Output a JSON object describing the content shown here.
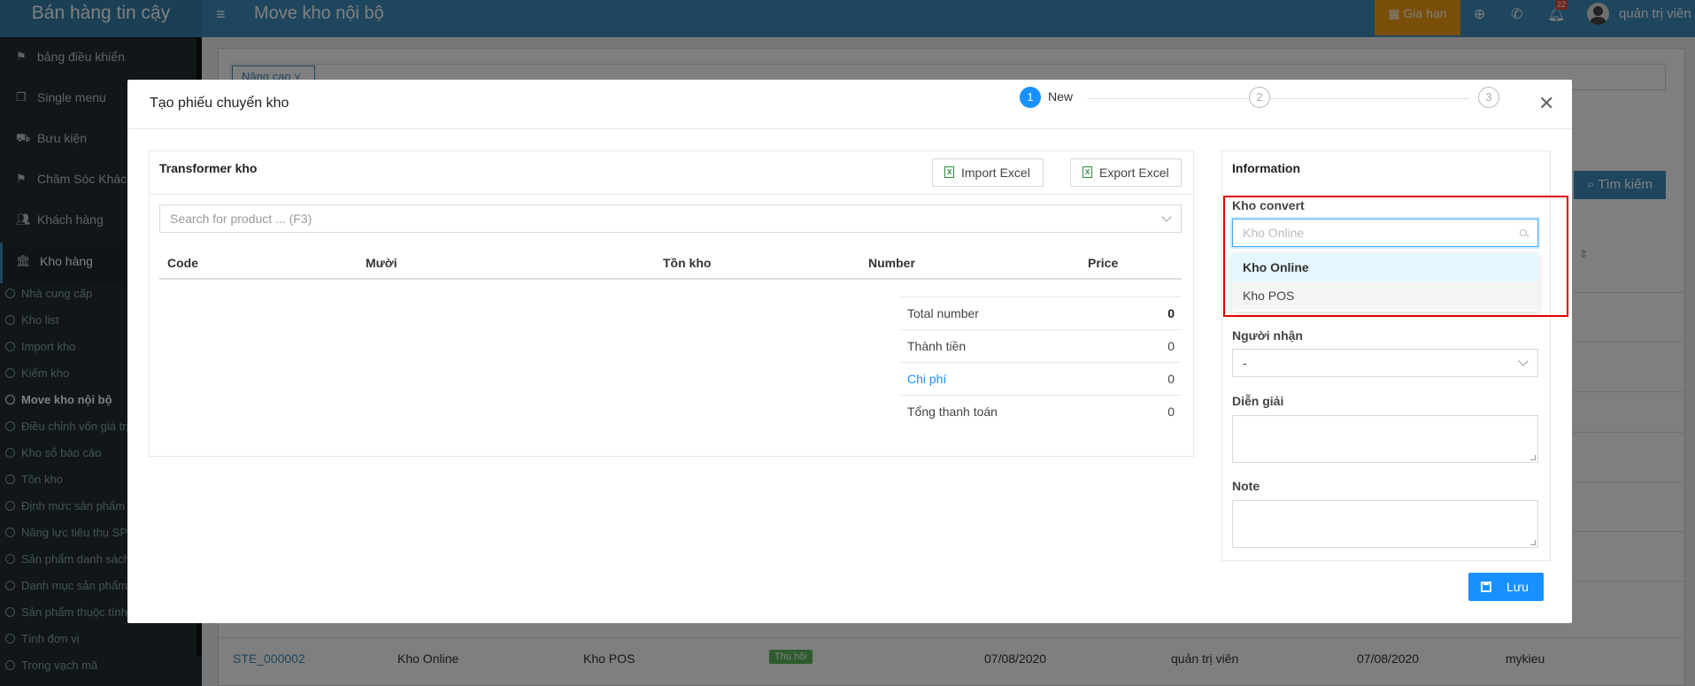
{
  "app": {
    "brand": "Bán hàng tin cậy",
    "page_title": "Move kho nội bộ"
  },
  "topbar": {
    "renew_label": "Gia hạn",
    "notif_count": "22",
    "user_name": "quản trị viên"
  },
  "sidebar": {
    "items": [
      {
        "label": "bảng điều khiển",
        "icon": "flag-icon"
      },
      {
        "label": "Single menu",
        "icon": "copy-icon"
      },
      {
        "label": "Bưu kiện",
        "icon": "truck-icon"
      },
      {
        "label": "Chăm Sóc Khách",
        "icon": "flag-icon"
      },
      {
        "label": "Khách hàng",
        "icon": "users-icon"
      },
      {
        "label": "Kho hàng",
        "icon": "bank-icon"
      }
    ],
    "subitems": [
      "Nhà cung cấp",
      "Kho list",
      "Import kho",
      "Kiểm kho",
      "Move kho nội bộ",
      "Điều chỉnh vốn giá trị",
      "Kho sổ báo cáo",
      "Tồn kho",
      "Định mức sản phẩm",
      "Năng lực tiêu thụ SP",
      "Sản phẩm danh sách",
      "Danh mục sản phẩm",
      "Sản phẩm thuộc tính",
      "Tính đơn vị",
      "Trong vạch mã"
    ],
    "current_subitem": 4
  },
  "background": {
    "filter_label": "Nâng cao",
    "search_label": "Tìm kiếm",
    "row": {
      "code": "STE_000002",
      "from": "Kho Online",
      "to": "Kho POS",
      "status": "Thu hồi",
      "date1": "07/08/2020",
      "user": "quản trị viên",
      "date2": "07/08/2020",
      "creator": "mykieu"
    }
  },
  "modal": {
    "title": "Tạo phiếu chuyển kho",
    "steps": [
      {
        "num": "1",
        "label": "New"
      },
      {
        "num": "2"
      },
      {
        "num": "3"
      }
    ],
    "left": {
      "title": "Transformer kho",
      "import_label": "Import Excel",
      "export_label": "Export Excel",
      "search_placeholder": "Search for product ... (F3)",
      "columns": [
        "Code",
        "Mười",
        "Tồn kho",
        "Number",
        "Price"
      ],
      "summary": [
        {
          "label": "Total number",
          "value": "0"
        },
        {
          "label": "Thành tiền",
          "value": "0"
        },
        {
          "label": "Chi phí",
          "value": "0"
        },
        {
          "label": "Tổng thanh toán",
          "value": "0"
        }
      ]
    },
    "right": {
      "title": "Information",
      "kho_label": "Kho convert",
      "kho_placeholder": "Kho Online",
      "options": [
        "Kho Online",
        "Kho POS"
      ],
      "receiver_label": "Người nhận",
      "receiver_value": "-",
      "desc_label": "Diễn giải",
      "note_label": "Note"
    },
    "save_label": "Lưu"
  }
}
